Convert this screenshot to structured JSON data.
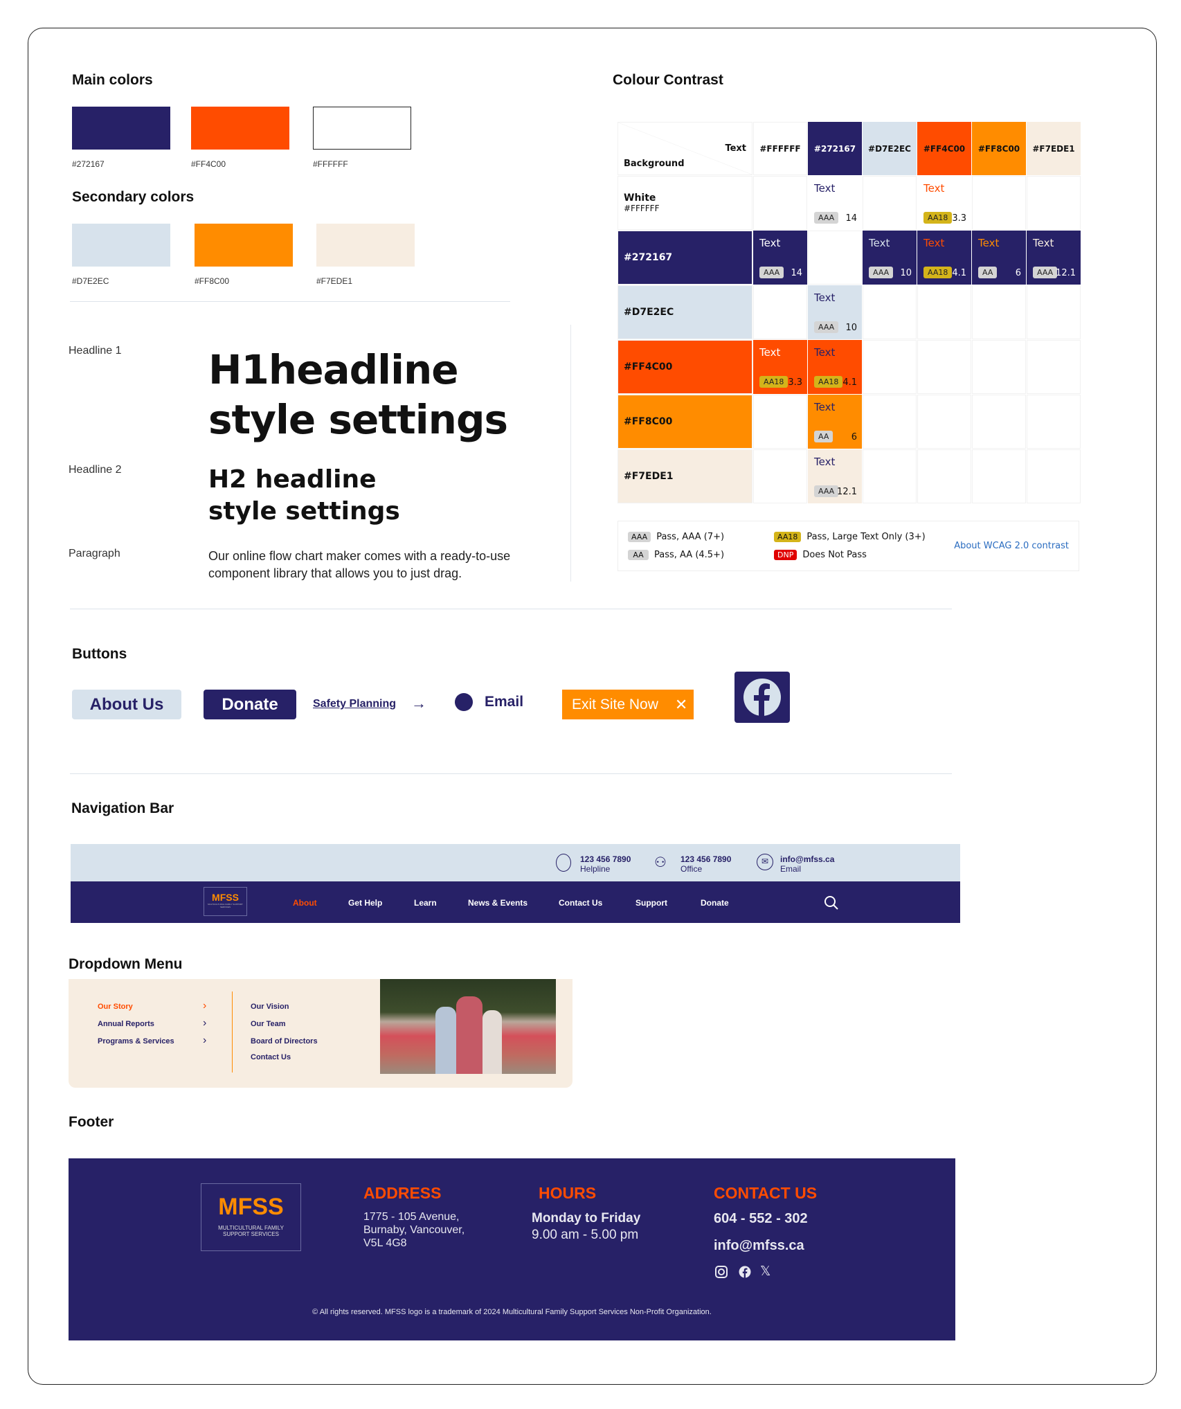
{
  "main_colors": {
    "title": "Main colors",
    "swatches": [
      {
        "hex": "#272167",
        "label": "#272167"
      },
      {
        "hex": "#FF4C00",
        "label": "#FF4C00"
      },
      {
        "hex": "#FFFFFF",
        "label": "#FFFFFF"
      }
    ]
  },
  "secondary_colors": {
    "title": "Secondary colors",
    "swatches": [
      {
        "hex": "#D7E2EC",
        "label": "#D7E2EC"
      },
      {
        "hex": "#FF8C00",
        "label": "#FF8C00"
      },
      {
        "hex": "#F7EDE1",
        "label": "#F7EDE1"
      }
    ]
  },
  "typography": {
    "h1_label": "Headline 1",
    "h1_line1": "H1headline",
    "h1_line2": "style settings",
    "h2_label": "Headline 2",
    "h2_line1": "H2 headline",
    "h2_line2": "style settings",
    "p_label": "Paragraph",
    "p_line1": "Our online flow chart maker comes with a ready-to-use",
    "p_line2": "component library that allows you to just drag."
  },
  "contrast": {
    "title": "Colour Contrast",
    "corner_text": "Text",
    "corner_bg": "Background",
    "cell_text": "Text",
    "columns": [
      {
        "label": "#FFFFFF",
        "hex": "#FFFFFF"
      },
      {
        "label": "#272167",
        "hex": "#272167"
      },
      {
        "label": "#D7E2EC",
        "hex": "#D7E2EC"
      },
      {
        "label": "#FF4C00",
        "hex": "#FF4C00"
      },
      {
        "label": "#FF8C00",
        "hex": "#FF8C00"
      },
      {
        "label": "#F7EDE1",
        "hex": "#F7EDE1"
      }
    ],
    "rows": [
      {
        "label": "White",
        "sub": "#FFFFFF",
        "hex": "#FFFFFF",
        "cells": [
          null,
          {
            "badge": "AAA",
            "ratio": "14"
          },
          null,
          {
            "badge": "AA18",
            "ratio": "3.3"
          },
          null,
          null
        ]
      },
      {
        "label": "#272167",
        "hex": "#272167",
        "cells": [
          {
            "badge": "AAA",
            "ratio": "14"
          },
          null,
          {
            "badge": "AAA",
            "ratio": "10"
          },
          {
            "badge": "AA18",
            "ratio": "4.1"
          },
          {
            "badge": "AA",
            "ratio": "6"
          },
          {
            "badge": "AAA",
            "ratio": "12.1"
          }
        ]
      },
      {
        "label": "#D7E2EC",
        "hex": "#D7E2EC",
        "cells": [
          null,
          {
            "badge": "AAA",
            "ratio": "10"
          },
          null,
          null,
          null,
          null
        ]
      },
      {
        "label": "#FF4C00",
        "hex": "#FF4C00",
        "cells": [
          {
            "badge": "AA18",
            "ratio": "3.3"
          },
          {
            "badge": "AA18",
            "ratio": "4.1"
          },
          null,
          null,
          null,
          null
        ]
      },
      {
        "label": "#FF8C00",
        "hex": "#FF8C00",
        "cells": [
          null,
          {
            "badge": "AA",
            "ratio": "6"
          },
          null,
          null,
          null,
          null
        ]
      },
      {
        "label": "#F7EDE1",
        "hex": "#F7EDE1",
        "cells": [
          null,
          {
            "badge": "AAA",
            "ratio": "12.1"
          },
          null,
          null,
          null,
          null
        ]
      }
    ],
    "legend": [
      {
        "badge": "AAA",
        "text": "Pass, AAA (7+)",
        "color": "#d4d4d4"
      },
      {
        "badge": "AA",
        "text": "Pass, AA (4.5+)",
        "color": "#d4d4d4"
      },
      {
        "badge": "AA18",
        "text": "Pass, Large Text Only (3+)",
        "color": "#d4b41a"
      },
      {
        "badge": "DNP",
        "text": "Does Not Pass",
        "color": "#e00000"
      }
    ],
    "link": "About WCAG 2.0 contrast"
  },
  "buttons": {
    "title": "Buttons",
    "about": "About Us",
    "donate": "Donate",
    "safety": "Safety Planning",
    "email": "Email",
    "exit": "Exit Site Now"
  },
  "navbar": {
    "title": "Navigation Bar",
    "helpline_num": "123 456 7890",
    "helpline": "Helpline",
    "office_num": "123 456 7890",
    "office": "Office",
    "email": "info@mfss.ca",
    "email_label": "Email",
    "logo": "MFSS",
    "logo_sub": "MULTICULTURAL FAMILY SUPPORT SERVICES",
    "items": [
      "About",
      "Get Help",
      "Learn",
      "News & Events",
      "Contact Us",
      "Support",
      "Donate"
    ],
    "active": "About"
  },
  "dropdown": {
    "title": "Dropdown Menu",
    "left": [
      "Our Story",
      "Annual Reports",
      "Programs & Services"
    ],
    "right": [
      "Our Vision",
      "Our Team",
      "Board of Directors",
      "Contact Us"
    ]
  },
  "footer": {
    "title": "Footer",
    "logo": "MFSS",
    "logo_sub1": "MULTICULTURAL FAMILY",
    "logo_sub2": "SUPPORT SERVICES",
    "address_h": "ADDRESS",
    "address": [
      "1775 - 105 Avenue,",
      "Burnaby, Vancouver,",
      "V5L 4G8"
    ],
    "hours_h": "HOURS",
    "hours_days": "Monday to Friday",
    "hours_time": "9.00 am - 5.00 pm",
    "contact_h": "CONTACT US",
    "phone": "604 - 552 - 302",
    "email": "info@mfss.ca",
    "copyright": "© All rights reserved. MFSS logo is a trademark of 2024 Multicultural Family Support Services Non-Profit Organization."
  }
}
